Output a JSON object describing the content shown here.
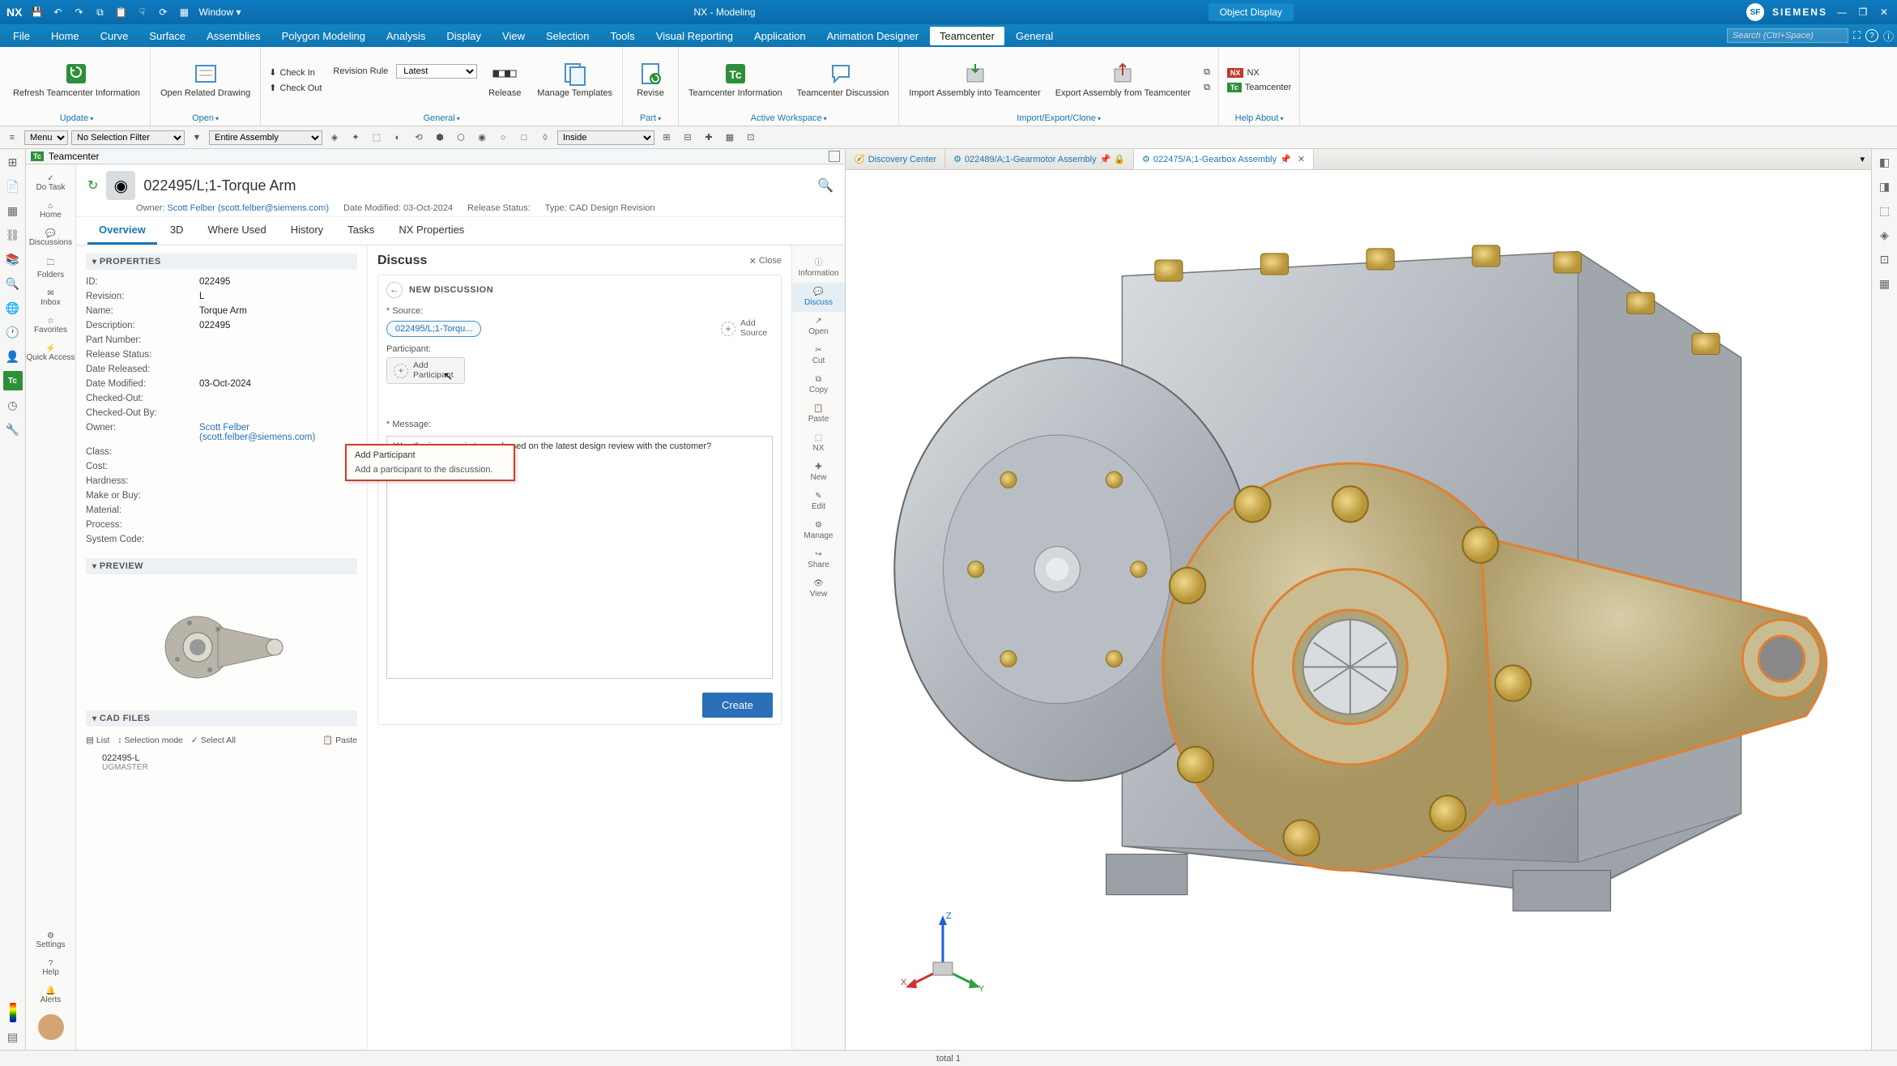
{
  "titlebar": {
    "logo": "NX",
    "window_menu": "Window",
    "app_title": "NX - Modeling",
    "object_display": "Object Display",
    "avatar": "SF",
    "brand": "SIEMENS"
  },
  "menubar": {
    "items": [
      "File",
      "Home",
      "Curve",
      "Surface",
      "Assemblies",
      "Polygon Modeling",
      "Analysis",
      "Display",
      "View",
      "Selection",
      "Tools",
      "Visual Reporting",
      "Application",
      "Animation Designer",
      "Teamcenter",
      "General"
    ],
    "active": "Teamcenter",
    "search_placeholder": "Search (Ctrl+Space)"
  },
  "ribbon": {
    "update": {
      "title": "Update",
      "refresh": "Refresh Teamcenter Information"
    },
    "open": {
      "title": "Open",
      "open_drawing": "Open Related Drawing"
    },
    "general": {
      "title": "General",
      "check_in": "Check In",
      "check_out": "Check Out",
      "rev_rule": "Revision Rule",
      "rev_value": "Latest",
      "release": "Release",
      "manage_templates": "Manage Templates"
    },
    "part": {
      "title": "Part",
      "revise": "Revise"
    },
    "aw": {
      "title": "Active Workspace",
      "tc_info": "Teamcenter Information",
      "tc_disc": "Teamcenter Discussion"
    },
    "iec": {
      "title": "Import/Export/Clone",
      "import": "Import Assembly into Teamcenter",
      "export": "Export Assembly from Teamcenter"
    },
    "help": {
      "title": "Help About",
      "nx": "NX",
      "tc": "Teamcenter"
    }
  },
  "quickbar": {
    "menu": "Menu",
    "filter": "No Selection Filter",
    "scope": "Entire Assembly",
    "inside": "Inside"
  },
  "tc_panel": {
    "title": "Teamcenter",
    "nav": {
      "do_task": "Do Task",
      "home": "Home",
      "discussions": "Discussions",
      "folders": "Folders",
      "inbox": "Inbox",
      "favorites": "Favorites",
      "quick": "Quick Access",
      "settings": "Settings",
      "help": "Help",
      "alerts": "Alerts"
    }
  },
  "item": {
    "title": "022495/L;1-Torque Arm",
    "owner_label": "Owner:",
    "owner": "Scott Felber (scott.felber@siemens.com)",
    "mod_label": "Date Modified:",
    "mod": "03-Oct-2024",
    "release_label": "Release Status:",
    "release": "",
    "type_label": "Type:",
    "type": "CAD Design Revision",
    "tabs": [
      "Overview",
      "3D",
      "Where Used",
      "History",
      "Tasks",
      "NX Properties"
    ]
  },
  "props": {
    "heading": "PROPERTIES",
    "rows": [
      {
        "k": "ID:",
        "v": "022495"
      },
      {
        "k": "Revision:",
        "v": "L"
      },
      {
        "k": "Name:",
        "v": "Torque Arm"
      },
      {
        "k": "Description:",
        "v": "022495"
      },
      {
        "k": "Part Number:",
        "v": ""
      },
      {
        "k": "Release Status:",
        "v": ""
      },
      {
        "k": "Date Released:",
        "v": ""
      },
      {
        "k": "Date Modified:",
        "v": "03-Oct-2024"
      },
      {
        "k": "Checked-Out:",
        "v": ""
      },
      {
        "k": "Checked-Out By:",
        "v": ""
      },
      {
        "k": "Owner:",
        "v": "Scott Felber (scott.felber@siemens.com)",
        "link": true
      },
      {
        "k": "Class:",
        "v": ""
      },
      {
        "k": "Cost:",
        "v": ""
      },
      {
        "k": "Hardness:",
        "v": ""
      },
      {
        "k": "Make or Buy:",
        "v": ""
      },
      {
        "k": "Material:",
        "v": ""
      },
      {
        "k": "Process:",
        "v": ""
      },
      {
        "k": "System Code:",
        "v": ""
      }
    ]
  },
  "preview": {
    "heading": "PREVIEW"
  },
  "cad": {
    "heading": "CAD FILES",
    "list": "List",
    "selmode": "Selection mode",
    "selall": "Select All",
    "paste": "Paste",
    "file": "022495-L",
    "file_sub": "UGMASTER"
  },
  "discuss": {
    "heading": "Discuss",
    "close": "Close",
    "new": "NEW DISCUSSION",
    "source_label": "Source:",
    "source_chip": "022495/L;1-Torqu...",
    "add_source": "Add Source",
    "participant_label": "Participant:",
    "add_participant": "Add Participant",
    "tooltip_title": "Add Participant",
    "tooltip_body": "Add a participant to the discussion.",
    "message_label": "Message:",
    "message_value": "Was the increase in torque based on the latest design review with the customer?",
    "create": "Create"
  },
  "actions": {
    "information": "Information",
    "discuss": "Discuss",
    "open": "Open",
    "cut": "Cut",
    "copy": "Copy",
    "paste": "Paste",
    "nx": "NX",
    "new": "New",
    "edit": "Edit",
    "manage": "Manage",
    "share": "Share",
    "view": "View"
  },
  "vp_tabs": {
    "discovery": "Discovery Center",
    "gear": "022489/A;1-Gearmotor Assembly",
    "gearbox": "022475/A;1-Gearbox Assembly"
  },
  "status": {
    "total": "total 1"
  }
}
